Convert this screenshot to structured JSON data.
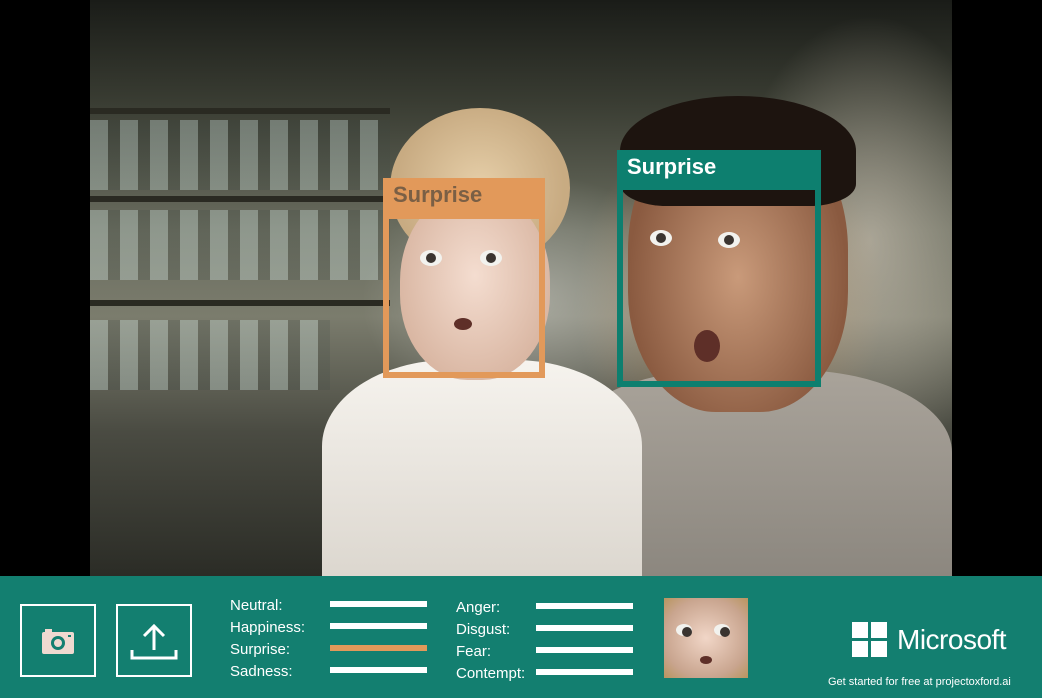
{
  "faces": [
    {
      "emotion_label": "Surprise",
      "color": "#e2995a"
    },
    {
      "emotion_label": "Surprise",
      "color": "#0d7f6f"
    }
  ],
  "toolbar": {
    "camera_icon": "camera-icon",
    "upload_icon": "upload-icon"
  },
  "emotions": {
    "left": [
      {
        "label": "Neutral:",
        "level": 0,
        "highlighted": false
      },
      {
        "label": "Happiness:",
        "level": 0,
        "highlighted": false
      },
      {
        "label": "Surprise:",
        "level": 1,
        "highlighted": true
      },
      {
        "label": "Sadness:",
        "level": 0,
        "highlighted": false
      }
    ],
    "right": [
      {
        "label": "Anger:",
        "level": 0,
        "highlighted": false
      },
      {
        "label": "Disgust:",
        "level": 0,
        "highlighted": false
      },
      {
        "label": "Fear:",
        "level": 0,
        "highlighted": false
      },
      {
        "label": "Contempt:",
        "level": 0,
        "highlighted": false
      }
    ]
  },
  "brand": {
    "name": "Microsoft",
    "cta": "Get started for free at projectoxford.ai"
  },
  "colors": {
    "panel": "#137f70",
    "accent_orange": "#e2995a",
    "accent_teal": "#0d7f6f"
  }
}
